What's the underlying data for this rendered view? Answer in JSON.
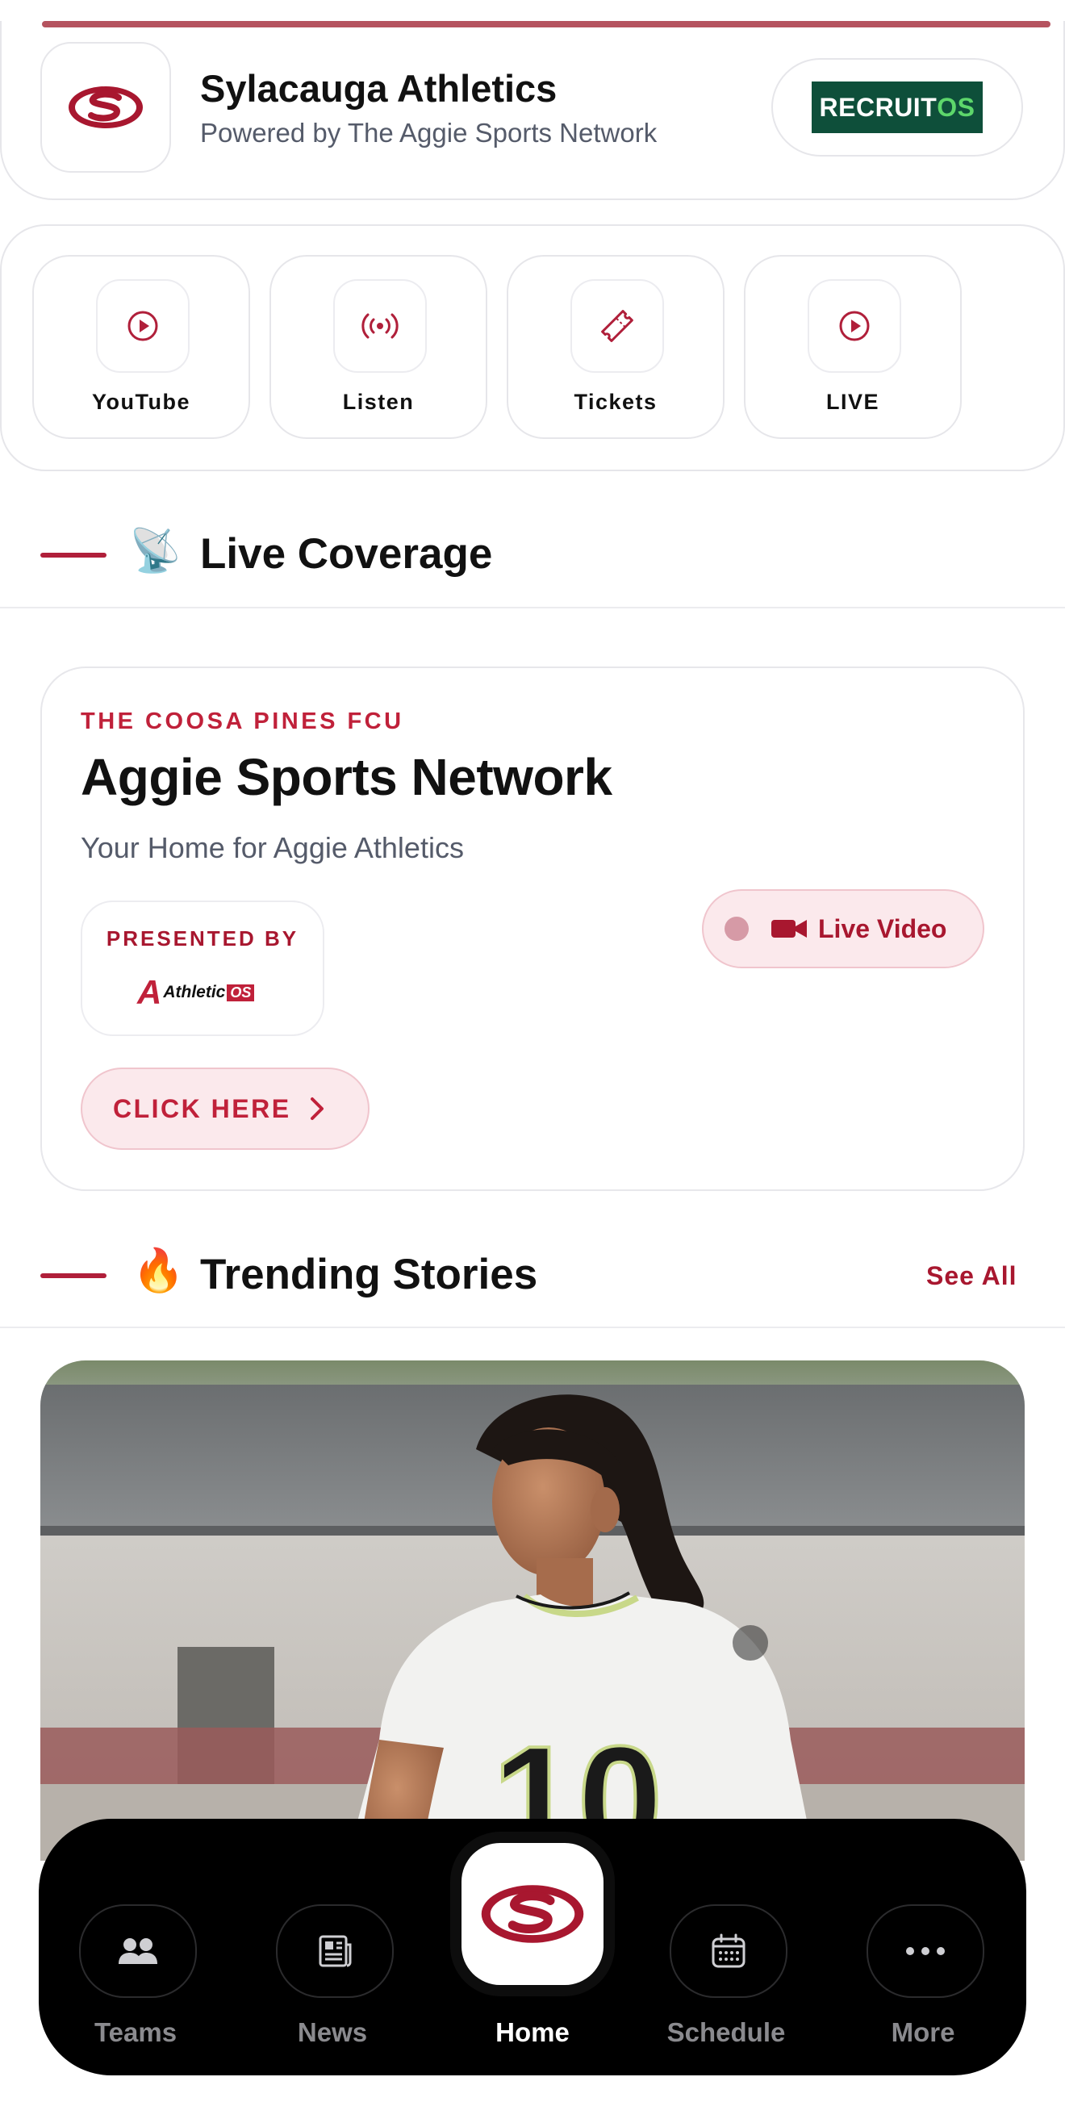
{
  "header": {
    "title": "Sylacauga Athletics",
    "subtitle": "Powered by The Aggie Sports Network",
    "logo_icon": "sylacauga-s-logo",
    "sponsor": {
      "name_main": "RECRUIT",
      "name_accent": "OS",
      "brand_color": "#0e4f3a",
      "accent_color": "#5dd66b"
    }
  },
  "quick_links": [
    {
      "label": "YouTube",
      "icon": "play-circle-icon"
    },
    {
      "label": "Listen",
      "icon": "broadcast-icon"
    },
    {
      "label": "Tickets",
      "icon": "ticket-icon"
    },
    {
      "label": "LIVE",
      "icon": "play-circle-icon"
    }
  ],
  "live_section": {
    "emoji": "📡",
    "title": "Live Coverage",
    "card": {
      "eyebrow": "THE COOSA PINES FCU",
      "title": "Aggie Sports Network",
      "tagline": "Your Home for Aggie Athletics",
      "presented_by_label": "PRESENTED BY",
      "presented_by_logo": {
        "mark": "A",
        "word": "Athletic",
        "suffix": "OS"
      },
      "live_video_label": "Live Video",
      "cta_label": "CLICK HERE"
    }
  },
  "trending_section": {
    "emoji": "🔥",
    "title": "Trending Stories",
    "see_all_label": "See All",
    "story_image": {
      "jersey_number": "10"
    }
  },
  "tab_bar": {
    "tabs": [
      {
        "label": "Teams",
        "icon": "people-icon"
      },
      {
        "label": "News",
        "icon": "newspaper-icon"
      },
      {
        "label": "Home",
        "icon": "sylacauga-s-logo",
        "active": true
      },
      {
        "label": "Schedule",
        "icon": "calendar-icon"
      },
      {
        "label": "More",
        "icon": "more-dots-icon"
      }
    ]
  },
  "colors": {
    "brand": "#b01f3a",
    "brand_light": "#fbe9ec",
    "text_primary": "#111111",
    "text_secondary": "#555b6a",
    "tab_bar_bg": "#000000"
  }
}
